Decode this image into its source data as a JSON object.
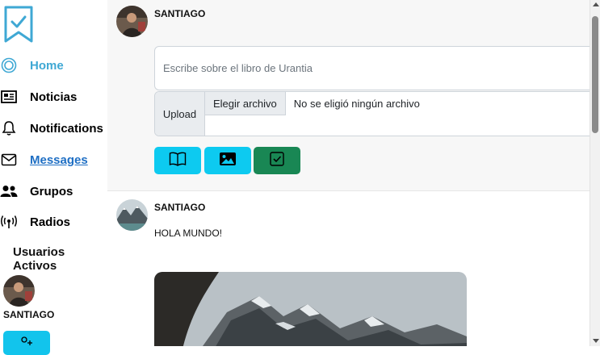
{
  "sidebar": {
    "items": [
      {
        "label": "Home",
        "icon": "home-icon"
      },
      {
        "label": "Noticias",
        "icon": "newspaper-icon"
      },
      {
        "label": "Notifications",
        "icon": "bell-icon"
      },
      {
        "label": "Messages",
        "icon": "envelope-icon"
      },
      {
        "label": "Grupos",
        "icon": "people-icon"
      },
      {
        "label": "Radios",
        "icon": "broadcast-icon"
      }
    ],
    "active_users_title": "Usuarios Activos",
    "active_users": [
      {
        "name": "SANTIAGO"
      }
    ]
  },
  "composer": {
    "username": "SANTIAGO",
    "placeholder": "Escribe sobre el libro de Urantia",
    "upload_label": "Upload",
    "file_button": "Elegir archivo",
    "file_status": "No se eligió ningún archivo",
    "buttons": [
      "book-icon",
      "image-icon",
      "check-square-icon"
    ]
  },
  "post": {
    "username": "SANTIAGO",
    "text": "HOLA MUNDO!"
  },
  "colors": {
    "accent": "#3fa8d4",
    "link": "#1f6fc4",
    "info_button": "#0dcaf0",
    "success_button": "#198754"
  }
}
